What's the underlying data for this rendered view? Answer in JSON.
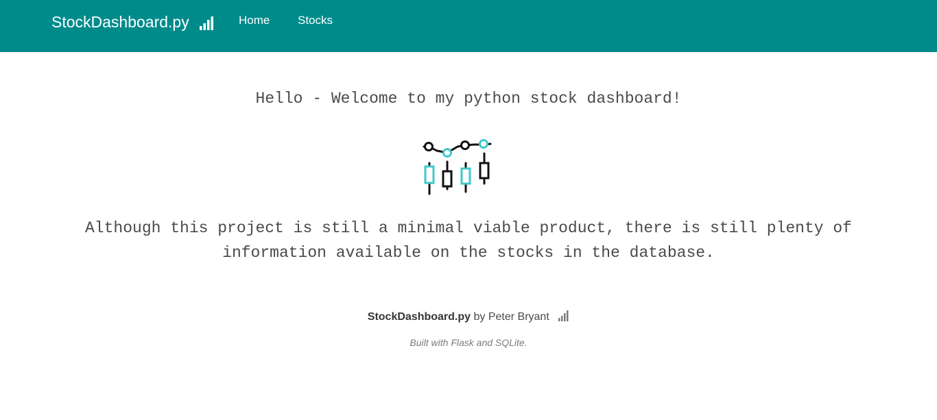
{
  "navbar": {
    "brand_label": "StockDashboard.py",
    "brand_icon": "signal-bars-icon",
    "background_color": "#008b8b",
    "links": [
      {
        "label": "Home"
      },
      {
        "label": "Stocks"
      }
    ]
  },
  "main": {
    "title": "Hello - Welcome to my python stock dashboard!",
    "logo_icon": "candlestick-chart-icon",
    "description": "Although this project is still a minimal viable product, there is still plenty of information available on the stocks in the database.",
    "accent_color": "#3fc8c8"
  },
  "footer": {
    "app_name": "StockDashboard.py",
    "by_text": "by Peter Bryant",
    "icon": "signal-bars-icon",
    "note": "Built with Flask and SQLite."
  }
}
